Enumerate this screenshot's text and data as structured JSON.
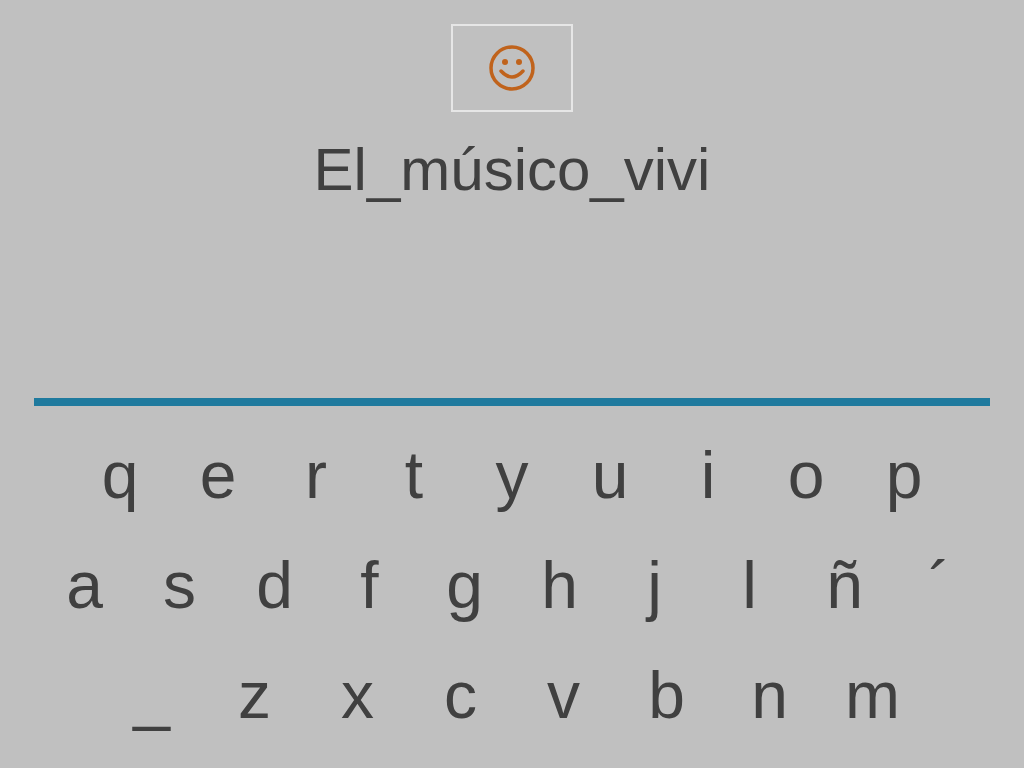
{
  "word": "El_músico_vivi",
  "keyboard": [
    [
      "q",
      "e",
      "r",
      "t",
      "y",
      "u",
      "i",
      "o",
      "p"
    ],
    [
      "a",
      "s",
      "d",
      "f",
      "g",
      "h",
      "j",
      "l",
      "ñ",
      "´"
    ],
    [
      "_",
      "z",
      "x",
      "c",
      "v",
      "b",
      "n",
      "m"
    ]
  ]
}
